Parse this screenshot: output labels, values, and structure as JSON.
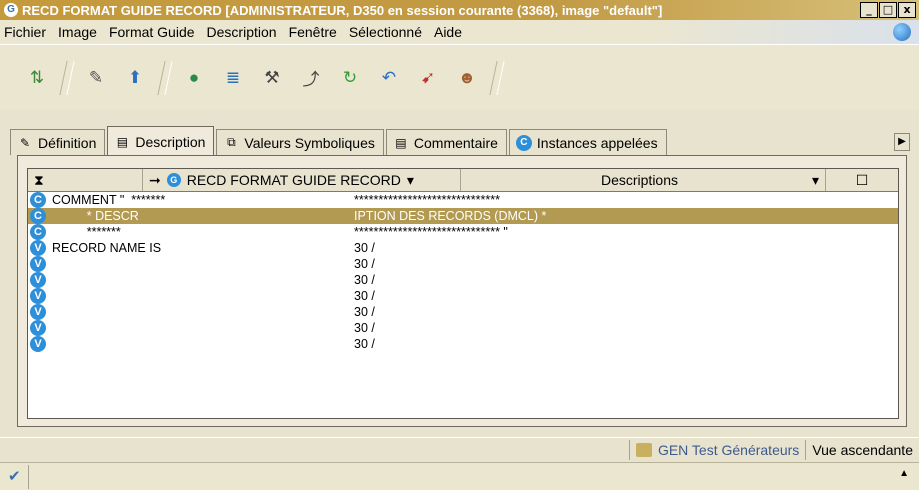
{
  "window": {
    "title": "RECD FORMAT GUIDE RECORD [ADMINISTRATEUR, D350 en session courante (3368), image \"default\"]",
    "app_icon": "G",
    "controls": {
      "minimize": "_",
      "maximize": "□",
      "close": "x"
    }
  },
  "menu": [
    "Fichier",
    "Image",
    "Format Guide",
    "Description",
    "Fenêtre",
    "Sélectionné",
    "Aide"
  ],
  "toolbar": {
    "icons": [
      "browse-icon",
      "tag-icon",
      "import-icon",
      "globe-icon",
      "list-icon",
      "wrench-icon",
      "arrows-icon",
      "refresh-icon",
      "undo-icon",
      "pin-icon",
      "user-icon"
    ]
  },
  "tabs": [
    {
      "label": "Définition",
      "icon": "edit-icon",
      "active": false
    },
    {
      "label": "Description",
      "icon": "document-icon",
      "active": true
    },
    {
      "label": "Valeurs Symboliques",
      "icon": "symbol-icon",
      "active": false
    },
    {
      "label": "Commentaire",
      "icon": "comment-icon",
      "active": false
    },
    {
      "label": "Instances appelées",
      "icon": "c-badge-icon",
      "active": false
    }
  ],
  "grid": {
    "header": {
      "record_icon": "G",
      "record_title": "RECD FORMAT GUIDE RECORD",
      "descriptions_label": "Descriptions"
    },
    "rows": [
      {
        "type": "C",
        "col1": "COMMENT \"  *******",
        "col2": "******************************",
        "selected": false
      },
      {
        "type": "C",
        "col1": "          * DESCR",
        "col2": "IPTION DES RECORDS (DMCL) *",
        "selected": true
      },
      {
        "type": "C",
        "col1": "          *******",
        "col2": "****************************** \"",
        "selected": false
      },
      {
        "type": "V",
        "col1": "RECORD NAME IS",
        "col2": "30 /",
        "selected": false
      },
      {
        "type": "V",
        "col1": "",
        "col2": "30 /",
        "selected": false
      },
      {
        "type": "V",
        "col1": "",
        "col2": "30 /",
        "selected": false
      },
      {
        "type": "V",
        "col1": "",
        "col2": "30 /",
        "selected": false
      },
      {
        "type": "V",
        "col1": "",
        "col2": "30 /",
        "selected": false
      },
      {
        "type": "V",
        "col1": "",
        "col2": "30 /",
        "selected": false
      },
      {
        "type": "V",
        "col1": "",
        "col2": "30 /",
        "selected": false
      }
    ]
  },
  "status": {
    "generator": "GEN Test Générateurs",
    "view": "Vue ascendante"
  },
  "colors": {
    "title_bar": "#c49a3c",
    "selected_row": "#b29a52",
    "badge": "#2d8fd8"
  }
}
